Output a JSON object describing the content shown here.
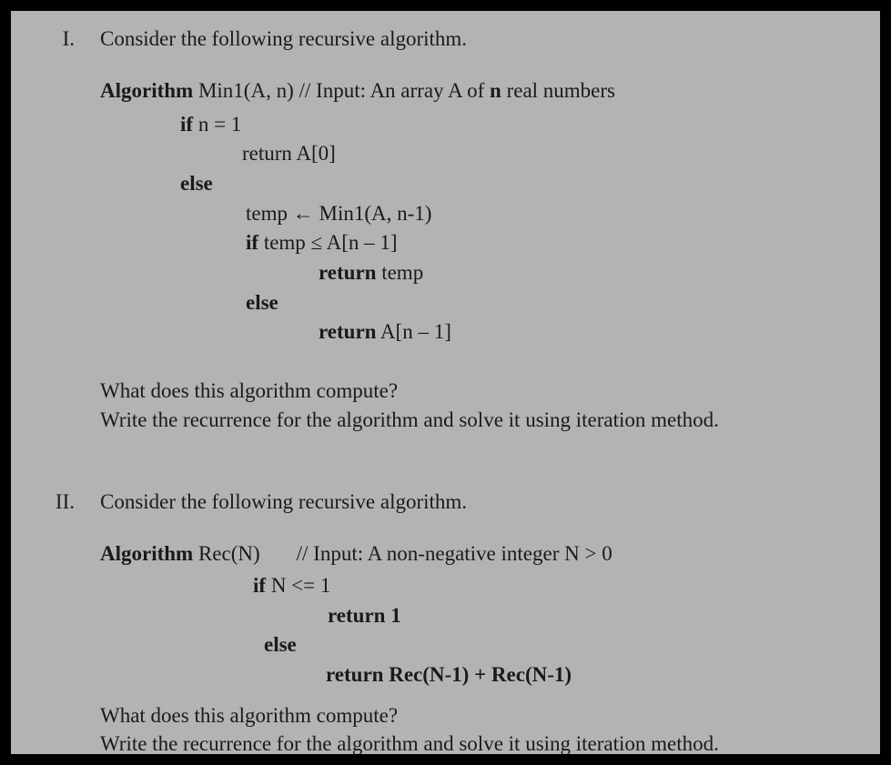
{
  "q1": {
    "number": "I.",
    "intro": "Consider the following recursive algorithm.",
    "alg_kw": "Algorithm",
    "alg_name": " Min1(A, n) ",
    "alg_comment": "// Input: An array A of ",
    "alg_comment_bold": "n",
    "alg_comment2": " real numbers",
    "l1_kw": "if",
    "l1_rest": " n = 1",
    "l2": "return A[0]",
    "l3_kw": "else",
    "l4": "temp ← Min1(A, n-1)",
    "l5_kw": "if",
    "l5_rest": " temp ≤  A[n – 1]",
    "l6_kw": "return",
    "l6_rest": " temp",
    "l7_kw": "else",
    "l8_kw": "return",
    "l8_rest": " A[n – 1]",
    "ask1": "What does this algorithm compute?",
    "ask2": "Write the recurrence for the algorithm and solve it using iteration method."
  },
  "q2": {
    "number": "II.",
    "intro": "Consider the following recursive algorithm.",
    "alg_kw": "Algorithm",
    "alg_name": " Rec(N)",
    "alg_comment": "// Input: A non-negative integer N > 0",
    "l1_kw": "if",
    "l1_rest": " N <=  1",
    "l2_kw": "return 1",
    "l3_kw": "else",
    "l4_kw": "return",
    "l4_rest": "  Rec(N-1) + Rec(N-1)",
    "ask1": "What does this algorithm compute?",
    "ask2": "Write the recurrence for the algorithm and solve it using iteration method."
  }
}
